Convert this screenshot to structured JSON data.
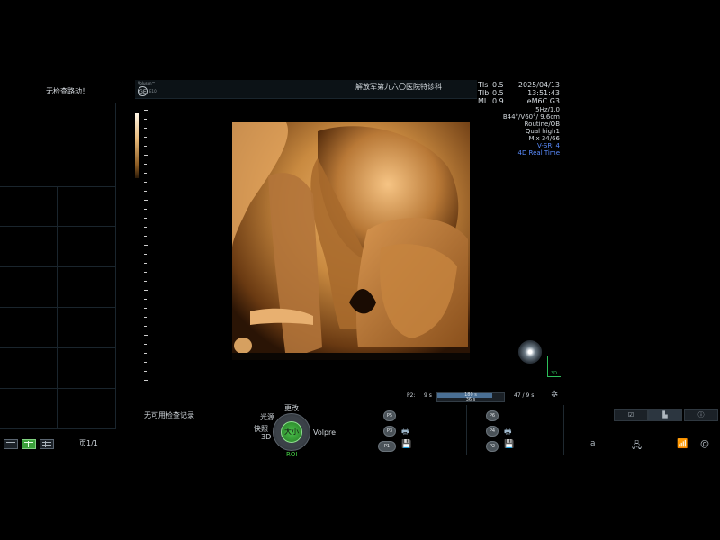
{
  "left_panel": {
    "title": "无检查路动！",
    "page_indicator": "页1/1"
  },
  "header": {
    "logo_small": "Voluson™",
    "logo_sub": "E10",
    "hospital": "解放军第九六〇医院特诊科",
    "indices": [
      {
        "label": "TIs",
        "value": "0.5"
      },
      {
        "label": "TIb",
        "value": "0.5"
      },
      {
        "label": "MI",
        "value": "0.9"
      }
    ],
    "date": "2025/04/13",
    "time": "13:51:43",
    "probe": "eM6C G3"
  },
  "params": {
    "lines": [
      "5Hz/1.0",
      "B44°/V60°/ 9.6cm",
      "Routine/OB",
      "Qual high1",
      "Mix 34/66"
    ],
    "blue_lines": [
      "V-SRI 4",
      "4D Real Time"
    ]
  },
  "axis3d_label": "3D",
  "cine": {
    "label": "P2:",
    "left": "9 s",
    "bar_top": "180 s",
    "bar_bottom": "36 s",
    "right": "47 / 9 s",
    "fill_fraction": 0.82
  },
  "records": {
    "no_records": "无可用检查记录"
  },
  "knob": {
    "top": "更改",
    "left_top": "光源",
    "left_mid": "快照",
    "left_bottom": "3D",
    "right": "Volpre",
    "center": "大小",
    "bottom": "ROI"
  },
  "pbuttons": {
    "p5": "P5",
    "p3": "P3",
    "p1": "P1",
    "p6": "P6",
    "p4": "P4",
    "p2": "P2"
  },
  "system": {
    "a_label": "a",
    "at_label": "@"
  },
  "colors": {
    "render_tone": "#d8944a",
    "accent_green": "#45d045",
    "accent_blue": "#5a8cff"
  }
}
